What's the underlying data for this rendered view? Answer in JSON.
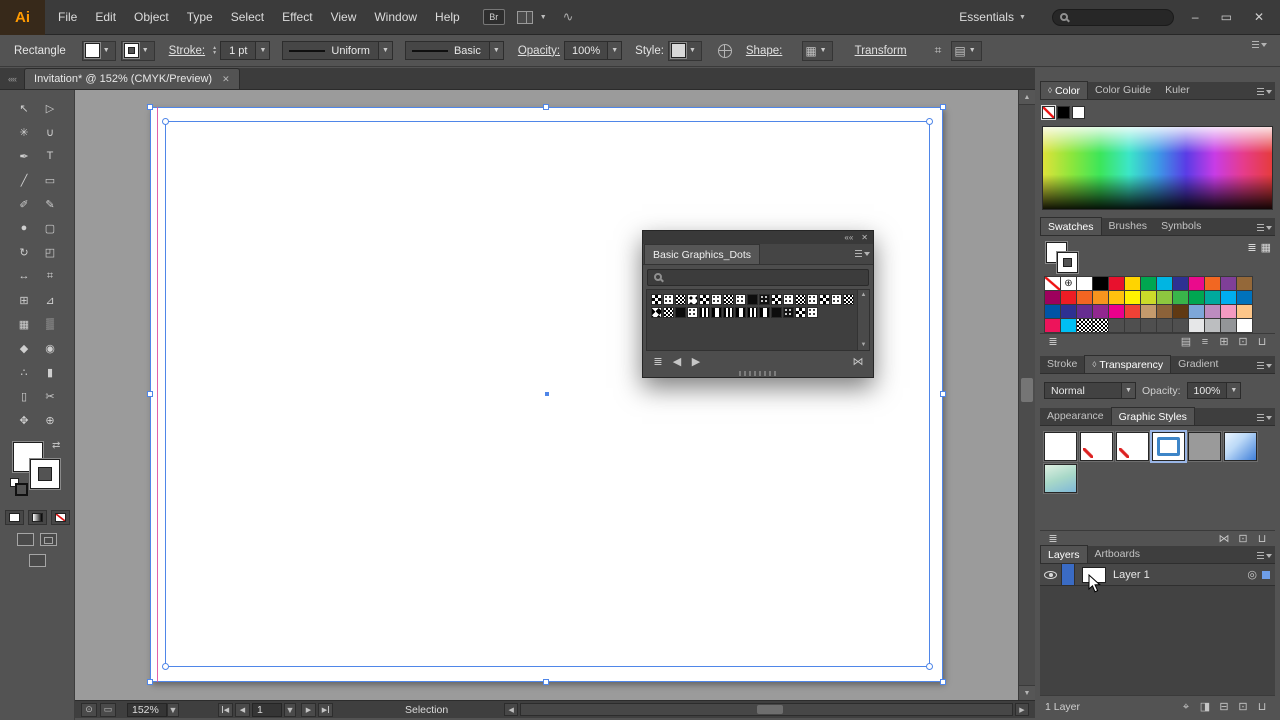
{
  "colors": {
    "selection": "#4f86e8",
    "guide": "#e0519e",
    "pasteboard": "#9b9b9b",
    "accent_orange": "#ff9a00"
  },
  "icons": {
    "minimize": "–",
    "restore": "▭",
    "close": "✕",
    "dropdown": "▼",
    "up": "▲",
    "left": "◀",
    "right": "▶",
    "collapse": "««",
    "tab_widget": "◊",
    "registration": "⊕",
    "target": "◎",
    "swap": "⇄",
    "library": "≣",
    "kinds": "▤",
    "options": "≡",
    "group": "⊞",
    "new": "⊡",
    "sublayer": "⊟",
    "trash": "⊔",
    "locate": "⌖",
    "clip": "◨",
    "unlink": "⋈",
    "list_view": "≣",
    "grid_view": "▦",
    "dot_circle": "⊙",
    "rect": "▭",
    "align": "⌗",
    "swirl": "∿"
  },
  "menubar": {
    "logo": "Ai",
    "items": [
      "File",
      "Edit",
      "Object",
      "Type",
      "Select",
      "Effect",
      "View",
      "Window",
      "Help"
    ],
    "bridge": "Br",
    "workspace": "Essentials"
  },
  "controlbar": {
    "tool_label": "Rectangle",
    "stroke_link": "Stroke:",
    "stroke_width": "1 pt",
    "profile_value": "Uniform",
    "brush_value": "Basic",
    "opacity_link": "Opacity:",
    "opacity_value": "100%",
    "style_label": "Style:",
    "shape_link": "Shape:",
    "transform_link": "Transform"
  },
  "tabbar": {
    "doc_title": "Invitation* @ 152% (CMYK/Preview)"
  },
  "tools": [
    {
      "name": "selection-tool",
      "glyph": "↖"
    },
    {
      "name": "direct-selection-tool",
      "glyph": "▷"
    },
    {
      "name": "magic-wand-tool",
      "glyph": "✳"
    },
    {
      "name": "lasso-tool",
      "glyph": "∪"
    },
    {
      "name": "pen-tool",
      "glyph": "✒"
    },
    {
      "name": "type-tool",
      "glyph": "T"
    },
    {
      "name": "line-segment-tool",
      "glyph": "╱"
    },
    {
      "name": "rectangle-tool",
      "glyph": "▭"
    },
    {
      "name": "paintbrush-tool",
      "glyph": "✐"
    },
    {
      "name": "pencil-tool",
      "glyph": "✎"
    },
    {
      "name": "blob-brush-tool",
      "glyph": "●"
    },
    {
      "name": "eraser-tool",
      "glyph": "▢"
    },
    {
      "name": "rotate-tool",
      "glyph": "↻"
    },
    {
      "name": "scale-tool",
      "glyph": "◰"
    },
    {
      "name": "width-tool",
      "glyph": "↔"
    },
    {
      "name": "free-transform-tool",
      "glyph": "⌗"
    },
    {
      "name": "shape-builder-tool",
      "glyph": "⊞"
    },
    {
      "name": "perspective-grid-tool",
      "glyph": "⊿"
    },
    {
      "name": "mesh-tool",
      "glyph": "▦"
    },
    {
      "name": "gradient-tool",
      "glyph": "▒"
    },
    {
      "name": "eyedropper-tool",
      "glyph": "◆"
    },
    {
      "name": "blend-tool",
      "glyph": "◉"
    },
    {
      "name": "symbol-sprayer-tool",
      "glyph": "∴"
    },
    {
      "name": "column-graph-tool",
      "glyph": "▮"
    },
    {
      "name": "artboard-tool",
      "glyph": "▯"
    },
    {
      "name": "slice-tool",
      "glyph": "✂"
    },
    {
      "name": "hand-tool",
      "glyph": "✥"
    },
    {
      "name": "zoom-tool",
      "glyph": "⊕"
    }
  ],
  "floating_panel": {
    "title": "Basic Graphics_Dots",
    "rows": [
      [
        "checker",
        "dots",
        "checker-sm",
        "dots-lg",
        "checker",
        "dots",
        "checker-sm",
        "dots",
        "solid",
        "dots-inv",
        "checker",
        "dots",
        "checker-sm",
        "dots",
        "checker",
        "dots",
        "checker-sm"
      ],
      [
        "diamond",
        "checker-sm",
        "solid",
        "dots",
        "lines",
        "lines-w",
        "lines",
        "lines-w",
        "lines",
        "lines-w",
        "solid",
        "dots-inv",
        "checker",
        "dots"
      ]
    ],
    "footer_left": [
      "library",
      "left",
      "right"
    ],
    "footer_right": [
      "unlink"
    ]
  },
  "statusbar": {
    "zoom": "152%",
    "page": "1",
    "mode": "Selection"
  },
  "panels": {
    "color": {
      "tabs": {
        "labels": [
          "Color",
          "Color Guide",
          "Kuler"
        ],
        "active": 0,
        "widget": true
      }
    },
    "swatches": {
      "tabs": {
        "labels": [
          "Swatches",
          "Brushes",
          "Symbols"
        ],
        "active": 0
      },
      "grid": [
        [
          "none",
          "registration",
          "#ffffff",
          "#000000",
          "#e8112d",
          "#ffd400",
          "#00a650",
          "#00b5e2",
          "#2e3192",
          "#ea0b8c",
          "#f26722",
          "#7f3f98",
          "#946839"
        ],
        [
          "#9e005d",
          "#ed1c24",
          "#f26522",
          "#f7941e",
          "#ffc20e",
          "#fff200",
          "#cbdb2a",
          "#8dc63f",
          "#39b54a",
          "#00a651",
          "#00a99d",
          "#00aeef",
          "#0072bc"
        ],
        [
          "#0054a6",
          "#2e3192",
          "#662d91",
          "#92278f",
          "#ec008c",
          "#ef4136",
          "#c49a6c",
          "#8c6239",
          "#603913",
          "#7da7d9",
          "#bd8cbf",
          "#f49ac1",
          "#fdc689"
        ],
        [
          "#ed145b",
          "#00bff3",
          "pattern",
          "pattern",
          "",
          "",
          "",
          "",
          "",
          "#e6e7e8",
          "#bcbec0",
          "#939598",
          "#ffffff"
        ]
      ],
      "footer_left": [
        "library"
      ],
      "footer_right": [
        "kinds",
        "options",
        "group",
        "new",
        "trash"
      ]
    },
    "transparency": {
      "tabs": {
        "labels": [
          "Stroke",
          "Transparency",
          "Gradient"
        ],
        "active": 1,
        "widget": true
      },
      "blend_mode": "Normal",
      "opacity_label": "Opacity:",
      "opacity_value": "100%"
    },
    "styles": {
      "tabs": {
        "labels": [
          "Appearance",
          "Graphic Styles"
        ],
        "active": 1
      },
      "items": [
        "default",
        "red-slash",
        "red-slash",
        "blue-border",
        "gray",
        "blue-img",
        "teal-img"
      ],
      "selected_index": 3,
      "footer_left": [
        "library"
      ],
      "footer_right": [
        "unlink",
        "new",
        "trash"
      ]
    },
    "layers": {
      "tabs": {
        "labels": [
          "Layers",
          "Artboards"
        ],
        "active": 0
      },
      "layer_name": "Layer 1",
      "count_label": "1 Layer",
      "footer_right": [
        "locate",
        "clip",
        "sublayer",
        "new",
        "trash"
      ]
    }
  }
}
